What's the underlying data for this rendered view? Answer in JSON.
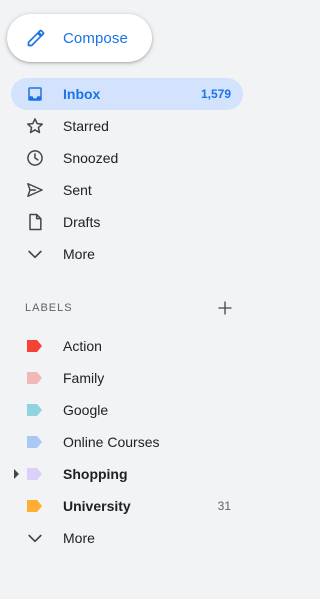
{
  "compose": {
    "label": "Compose",
    "icon": "pencil-icon",
    "color": "#1a73e8"
  },
  "nav": {
    "items": [
      {
        "label": "Inbox",
        "count": "1,579",
        "icon": "inbox-icon",
        "active": true
      },
      {
        "label": "Starred",
        "icon": "star-icon"
      },
      {
        "label": "Snoozed",
        "icon": "clock-icon"
      },
      {
        "label": "Sent",
        "icon": "send-icon"
      },
      {
        "label": "Drafts",
        "icon": "draft-icon"
      },
      {
        "label": "More",
        "icon": "chevron-down-icon"
      }
    ]
  },
  "labels": {
    "title": "LABELS",
    "add_icon": "plus-icon",
    "items": [
      {
        "label": "Action",
        "color": "#f44336"
      },
      {
        "label": "Family",
        "color": "#f2b8b5"
      },
      {
        "label": "Google",
        "color": "#8fd3e0"
      },
      {
        "label": "Online Courses",
        "color": "#a9c8f5"
      },
      {
        "label": "Shopping",
        "color": "#dcd0fb",
        "bold": true,
        "expandable": true
      },
      {
        "label": "University",
        "color": "#ffad33",
        "bold": true,
        "count": "31"
      },
      {
        "label": "More",
        "icon": "chevron-down-icon"
      }
    ]
  },
  "colors": {
    "background": "#f1f3f4",
    "active_bg": "#d3e3fd",
    "accent": "#1a73e8"
  }
}
